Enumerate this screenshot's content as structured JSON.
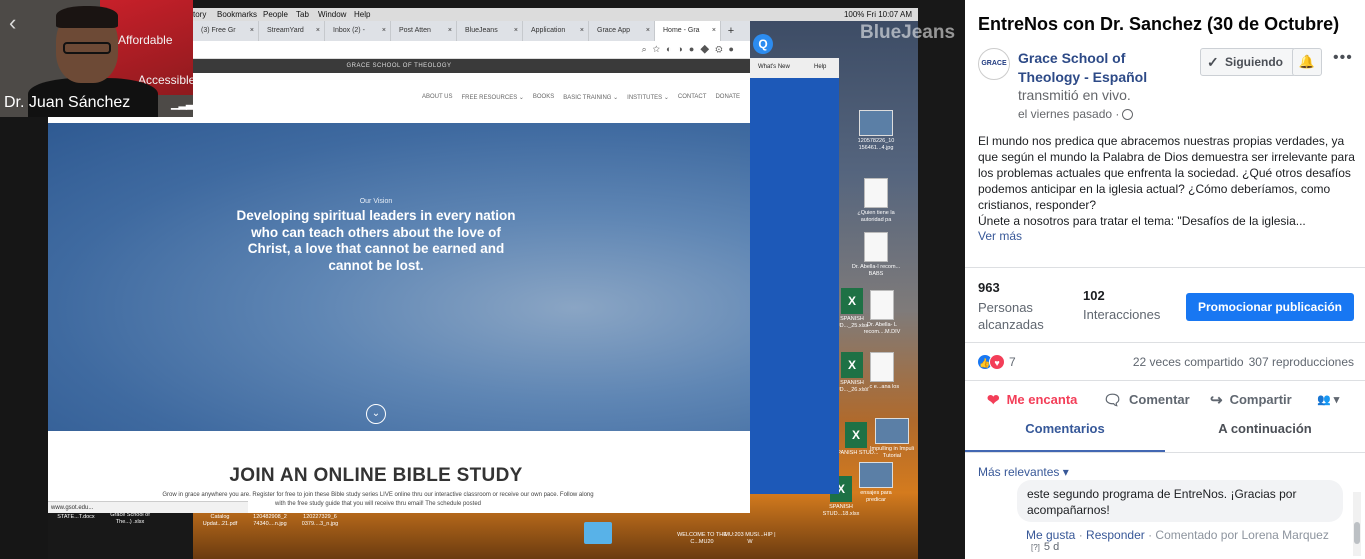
{
  "video": {
    "presenter_name": "Dr. Juan Sánchez",
    "banner_words": [
      "Affordable",
      "Accessible"
    ],
    "mac_menu": [
      "tory",
      "Bookmarks",
      "People",
      "Tab",
      "Window",
      "Help"
    ],
    "mac_status": "100% Fri 10:07 AM",
    "browser_tabs": [
      "(3) Free Gr",
      "StreamYard",
      "Inbox (2) -",
      "Post Atten",
      "BlueJeans",
      "Application",
      "Grace App",
      "Home - Gra"
    ],
    "site_header": "GRACE SCHOOL OF THEOLOGY",
    "site_nav": [
      "ABOUT US",
      "FREE RESOURCES ⌄",
      "BOOKS",
      "BASIC TRAINING ⌄",
      "INSTITUTES ⌄",
      "CONTACT",
      "DONATE"
    ],
    "hero_kicker": "Our Vision",
    "hero_tagline": "Developing spiritual leaders in every nation who can teach others about the love of Christ, a love that cannot be earned and cannot be lost.",
    "study_heading": "JOIN AN ONLINE BIBLE STUDY",
    "study_text": "Grow in grace anywhere you are. Register for free to join these Bible study series LIVE online thru our interactive classroom or receive our own pace. Follow along with the free study guide that you will receive thru email! The schedule posted",
    "status_url": "www.gsot.edu...",
    "bluejeans_label": "BlueJeans",
    "bj_menu": [
      "What's New",
      "Help"
    ],
    "desktop_icons": [
      "120578226_10 156461...4.jpg",
      "¿Quien tiene la autoridad pa",
      "Dr. Abella-I recom... BABS",
      "SPANISH UD..._25.xlsx",
      "Dr. Abella- L recom....M.DIV",
      "SPANISH UD..._26.xlsx",
      "...c e...ana los",
      "SPANISH STUD...",
      "Impulling in Impuli Tutorial",
      "ensajes para predicar",
      "SPANISH STUD...18.xlsx",
      "Grace School of The...) .xlsx",
      "Catalog Updat...21.pdf",
      "120482908_2 74340....n.jpg",
      "120227329_6 0379....3_n.jpg",
      "WELCOME TO THE C...MU20",
      "MU:203 MUSI...HIP | W",
      "STATE...T.docx"
    ]
  },
  "panel": {
    "post_title": "EntreNos con Dr. Sanchez (30 de Octubre)",
    "page_logo_text": "GRACE",
    "page_name": "Grace School of Theology - Español",
    "live_text": "transmitió en vivo.",
    "post_time": "el viernes pasado ·",
    "follow_label": "Siguiendo",
    "post_body": "El mundo nos predica que abracemos nuestras propias verdades, ya que según el mundo la Palabra de Dios demuestra ser irrelevante para los problemas actuales que enfrenta la sociedad. ¿Qué otros desafíos podemos anticipar en la iglesia actual? ¿Cómo deberíamos, como cristianos, responder?\nÚnete a nosotros para tratar el tema: \"Desafíos de la iglesia...",
    "see_more": "Ver más",
    "reach_count": "963",
    "reach_label": "Personas alcanzadas",
    "interactions_count": "102",
    "interactions_label": "Interacciones",
    "promote_label": "Promocionar publicación",
    "reaction_count": "7",
    "shares": "22 veces compartido",
    "views": "307 reproducciones",
    "actions": {
      "love": "Me encanta",
      "comment": "Comentar",
      "share": "Compartir"
    },
    "tabs": {
      "comments": "Comentarios",
      "next": "A continuación"
    },
    "sort_label": "Más relevantes",
    "comment_text": "este segundo programa de EntreNos. ¡Gracias por acompañarnos!",
    "comment_like": "Me gusta",
    "comment_reply": "Responder",
    "comment_by": "Comentado por Lorena Marquez",
    "comment_age": "5 d",
    "comment_age_badge": "[?]",
    "colors": {
      "accent": "#1877f2",
      "link": "#385898",
      "love": "#f33e58"
    }
  }
}
